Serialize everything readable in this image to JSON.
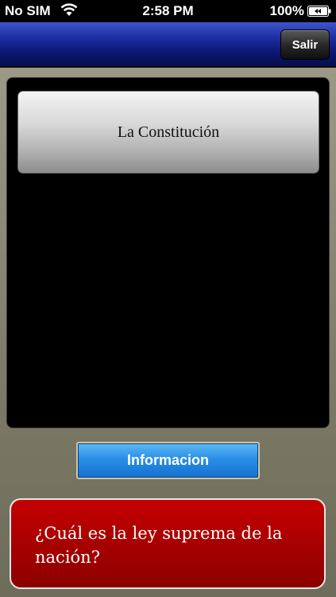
{
  "status_bar": {
    "carrier": "No SIM",
    "time": "2:58 PM",
    "battery": "100%"
  },
  "nav_bar": {
    "exit_label": "Salir"
  },
  "answer": {
    "text": "La Constitución"
  },
  "info_button": {
    "label": "Informacion"
  },
  "question": {
    "text": "¿Cuál es la ley suprema de la nación?"
  },
  "colors": {
    "nav_bar": "#1d2fa2",
    "info_button": "#2a8fe6",
    "question_box": "#a80000",
    "background": "#8a8874"
  },
  "icons": {
    "wifi": "wifi-icon",
    "battery": "battery-icon"
  }
}
